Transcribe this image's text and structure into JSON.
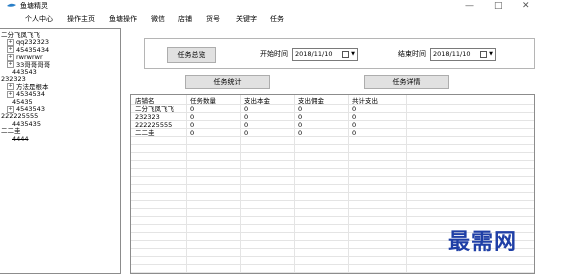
{
  "window": {
    "title": "鱼塘精灵",
    "min": "—",
    "max": "□",
    "close": "✕"
  },
  "menu": [
    "个人中心",
    "操作主页",
    "鱼塘操作",
    "微信",
    "店铺",
    "货号",
    "关键字",
    "任务"
  ],
  "tree": [
    {
      "text": "二分飞凤飞飞",
      "exp": "",
      "strike": false
    },
    {
      "text": "qq232323",
      "exp": "+",
      "strike": false
    },
    {
      "text": "45435434",
      "exp": "+",
      "strike": false
    },
    {
      "text": "rwrwrwr",
      "exp": "+",
      "strike": false
    },
    {
      "text": "33哥哥哥哥",
      "exp": "+",
      "strike": false
    },
    {
      "text": "443543",
      "exp": "",
      "strike": false
    },
    {
      "text": "232323",
      "exp": "",
      "strike": false
    },
    {
      "text": "方法是根本",
      "exp": "+",
      "strike": false
    },
    {
      "text": "4534534",
      "exp": "+",
      "strike": false
    },
    {
      "text": "45435",
      "exp": "",
      "strike": false
    },
    {
      "text": "4543543",
      "exp": "+",
      "strike": false
    },
    {
      "text": "222225555",
      "exp": "",
      "strike": false
    },
    {
      "text": "4435435",
      "exp": "",
      "strike": false
    },
    {
      "text": "二二圭",
      "exp": "",
      "strike": false
    },
    {
      "text": "4444",
      "exp": "",
      "strike": true
    }
  ],
  "toolbar": {
    "task_overview": "任务总览",
    "start_label": "开始时间",
    "start_date": "2018/11/10",
    "end_label": "结束时间",
    "end_date": "2018/11/10",
    "task_stats": "任务统计",
    "task_detail": "任务详情"
  },
  "table": {
    "headers": [
      "店铺名",
      "任务数量",
      "支出本金",
      "支出佣金",
      "共计支出"
    ],
    "rows": [
      [
        "二分飞凤飞飞",
        "0",
        "0",
        "0",
        "0"
      ],
      [
        "232323",
        "0",
        "0",
        "0",
        "0"
      ],
      [
        "222225555",
        "0",
        "0",
        "0",
        "0"
      ],
      [
        "二二圭",
        "0",
        "0",
        "0",
        "0"
      ]
    ]
  },
  "watermark": "最需网"
}
